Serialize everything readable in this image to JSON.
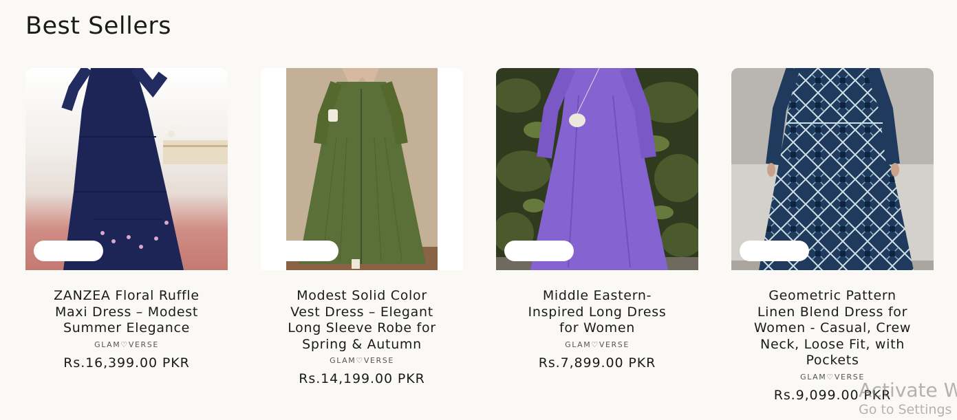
{
  "section": {
    "title": "Best Sellers"
  },
  "products": [
    {
      "title": "ZANZEA Floral Ruffle Maxi Dress – Modest Summer Elegance",
      "vendor": "GLAM♡VERSE",
      "price": "Rs.16,399.00 PKR",
      "badge": "",
      "image": "navy-maxi-dress-photo"
    },
    {
      "title": "Modest Solid Color Vest Dress – Elegant Long Sleeve Robe for Spring & Autumn",
      "vendor": "GLAM♡VERSE",
      "price": "Rs.14,199.00 PKR",
      "badge": "",
      "image": "green-vest-dress-photo"
    },
    {
      "title": "Middle Eastern-Inspired Long Dress for Women",
      "vendor": "GLAM♡VERSE",
      "price": "Rs.7,899.00 PKR",
      "badge": "",
      "image": "purple-long-dress-photo"
    },
    {
      "title": "Geometric Pattern Linen Blend Dress for Women - Casual, Crew Neck, Loose Fit, with Pockets",
      "vendor": "GLAM♡VERSE",
      "price": "Rs.9,099.00 PKR",
      "badge": "",
      "image": "geometric-pattern-dress-photo"
    }
  ],
  "watermark": {
    "line1": "Activate W",
    "line2": "Go to Settings"
  }
}
